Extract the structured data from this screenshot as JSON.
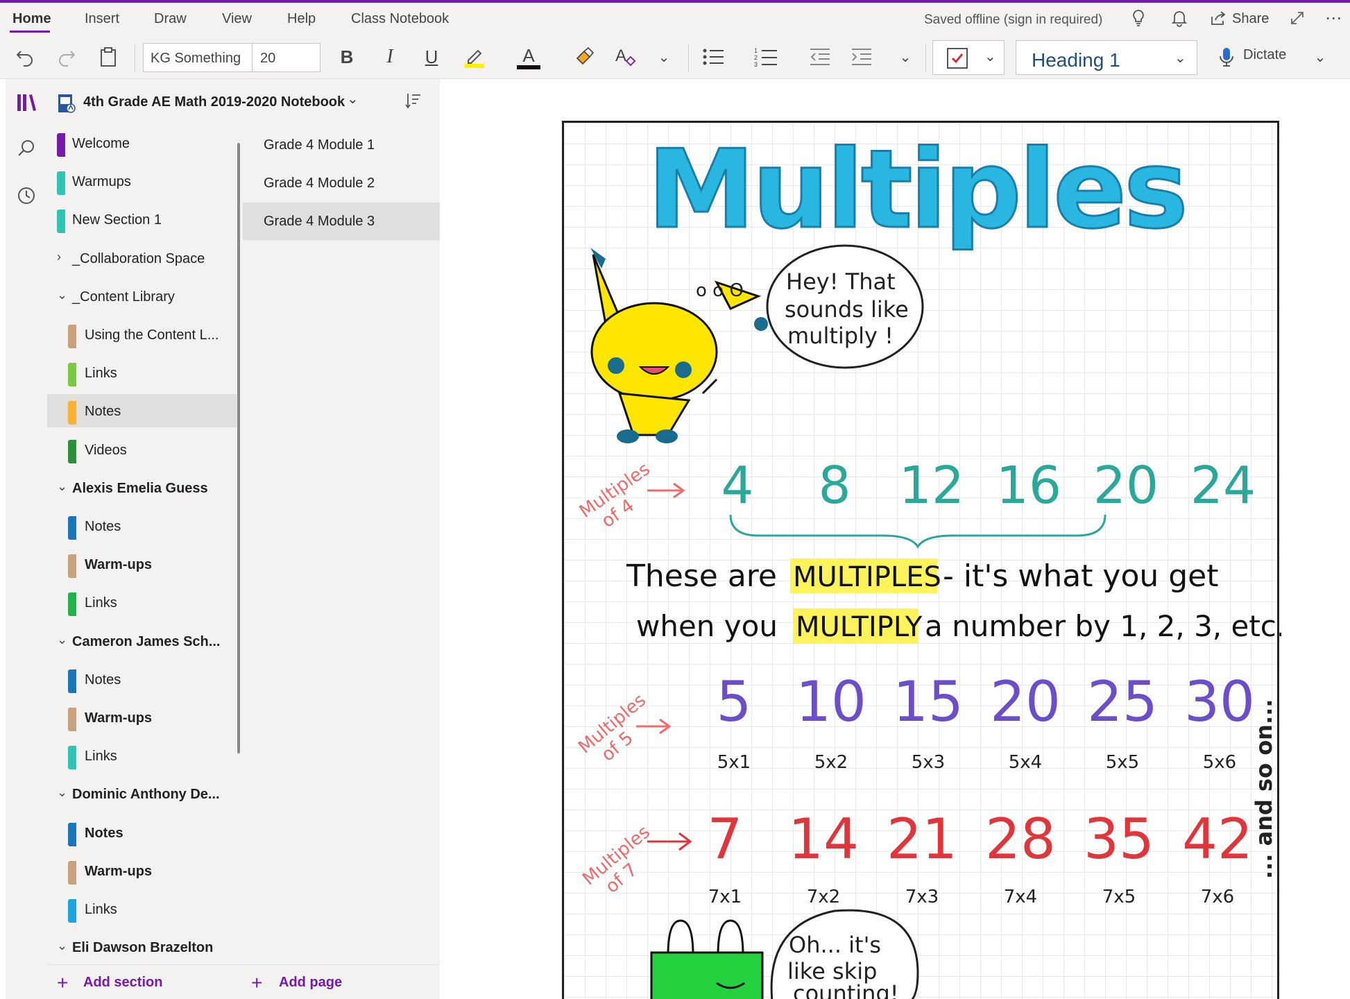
{
  "menubar": {
    "tabs": [
      "Home",
      "Insert",
      "Draw",
      "View",
      "Help",
      "Class Notebook"
    ],
    "status": "Saved offline (sign in required)",
    "share_label": "Share"
  },
  "toolbar": {
    "font_name": "KG Something",
    "font_size": "20",
    "bold": "B",
    "italic": "I",
    "underline": "U",
    "font_color_glyph": "A",
    "style": "Heading 1",
    "dictate_label": "Dictate"
  },
  "notebook": {
    "title": "4th Grade AE Math 2019-2020 Notebook"
  },
  "sections": [
    {
      "label": "Welcome",
      "color": "#7719aa",
      "bold": false
    },
    {
      "label": "Warmups",
      "color": "#2ec4b6",
      "bold": false
    },
    {
      "label": "New Section 1",
      "color": "#2ec4b6",
      "bold": false
    },
    {
      "label": "_Collaboration Space",
      "bold": false
    },
    {
      "label": "_Content Library",
      "bold": false
    },
    {
      "label": "Using the Content L...",
      "color": "#c8a27c",
      "bold": false
    },
    {
      "label": "Links",
      "color": "#7ac943",
      "bold": false
    },
    {
      "label": "Notes",
      "color": "#f9b233",
      "bold": false
    },
    {
      "label": "Videos",
      "color": "#2d8f3c",
      "bold": false
    },
    {
      "label": "Alexis Emelia Guess",
      "bold": true
    },
    {
      "label": "Notes",
      "color": "#1b75bc",
      "bold": false
    },
    {
      "label": "Warm-ups",
      "color": "#c8a27c",
      "bold": true
    },
    {
      "label": "Links",
      "color": "#21b24b",
      "bold": false
    },
    {
      "label": "Cameron James Sch...",
      "bold": true
    },
    {
      "label": "Notes",
      "color": "#1b75bc",
      "bold": false
    },
    {
      "label": "Warm-ups",
      "color": "#c8a27c",
      "bold": true
    },
    {
      "label": "Links",
      "color": "#2ec4b6",
      "bold": false
    },
    {
      "label": "Dominic Anthony De...",
      "bold": true
    },
    {
      "label": "Notes",
      "color": "#1b75bc",
      "bold": true
    },
    {
      "label": "Warm-ups",
      "color": "#c8a27c",
      "bold": true
    },
    {
      "label": "Links",
      "color": "#1ea5e0",
      "bold": false
    },
    {
      "label": "Eli Dawson Brazelton",
      "bold": true
    }
  ],
  "pages": [
    "Grade 4 Module 1",
    "Grade 4 Module 2",
    "Grade 4 Module 3"
  ],
  "add_section": "Add section",
  "add_page": "Add page",
  "poster": {
    "title": "Multiples",
    "bubble1": [
      "Hey! That",
      "sounds like",
      "multiply !"
    ],
    "dots": "o o O",
    "row4": {
      "label": [
        "Multiples",
        "of 4"
      ],
      "values": [
        "4",
        "8",
        "12",
        "16",
        "20",
        "24"
      ]
    },
    "sentence": {
      "line1_a": "These are",
      "line1_b": "MULTIPLES",
      "line1_c": "- it's what you get",
      "line2_a": "when you",
      "line2_b": "MULTIPLY",
      "line2_c": "a number by 1, 2, 3, etc."
    },
    "row5": {
      "label": [
        "Multiples",
        "of 5"
      ],
      "values": [
        "5",
        "10",
        "15",
        "20",
        "25",
        "30"
      ],
      "facts": [
        "5x1",
        "5x2",
        "5x3",
        "5x4",
        "5x5",
        "5x6"
      ]
    },
    "row7": {
      "label": [
        "Multiples",
        "of 7"
      ],
      "values": [
        "7",
        "14",
        "21",
        "28",
        "35",
        "42"
      ],
      "facts": [
        "7x1",
        "7x2",
        "7x3",
        "7x4",
        "7x5",
        "7x6"
      ]
    },
    "side": "... and so on...",
    "bubble2": [
      "Oh... it's",
      "like skip",
      "counting!"
    ],
    "colors": {
      "title": "#29b6e0",
      "row4": "#2aa89a",
      "row5": "#6a4fc8",
      "row7": "#e0353a",
      "highlight": "#fff35c",
      "label": "#ef6b6b"
    }
  }
}
